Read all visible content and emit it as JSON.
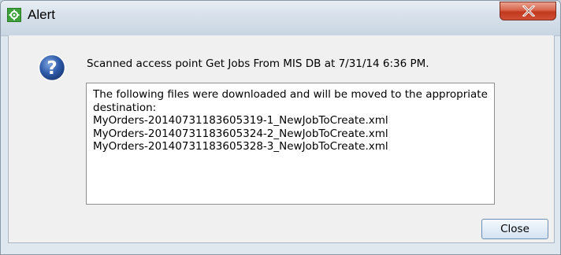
{
  "window": {
    "title": "Alert",
    "app_icon": "gear-icon",
    "close_icon": "close-icon",
    "accent_colors": {
      "close_button": "#c1391f",
      "app_icon": "#3da23a",
      "question_icon": "#2d5aa8"
    }
  },
  "dialog": {
    "icon": "question-icon",
    "header": "Scanned access point Get Jobs From MIS DB at 7/31/14 6:36 PM.",
    "message_lines": [
      "The following files were downloaded and will be moved to the appropriate",
      "destination:",
      "MyOrders-20140731183605319-1_NewJobToCreate.xml",
      "MyOrders-20140731183605324-2_NewJobToCreate.xml",
      "MyOrders-20140731183605328-3_NewJobToCreate.xml"
    ],
    "close_label": "Close"
  }
}
